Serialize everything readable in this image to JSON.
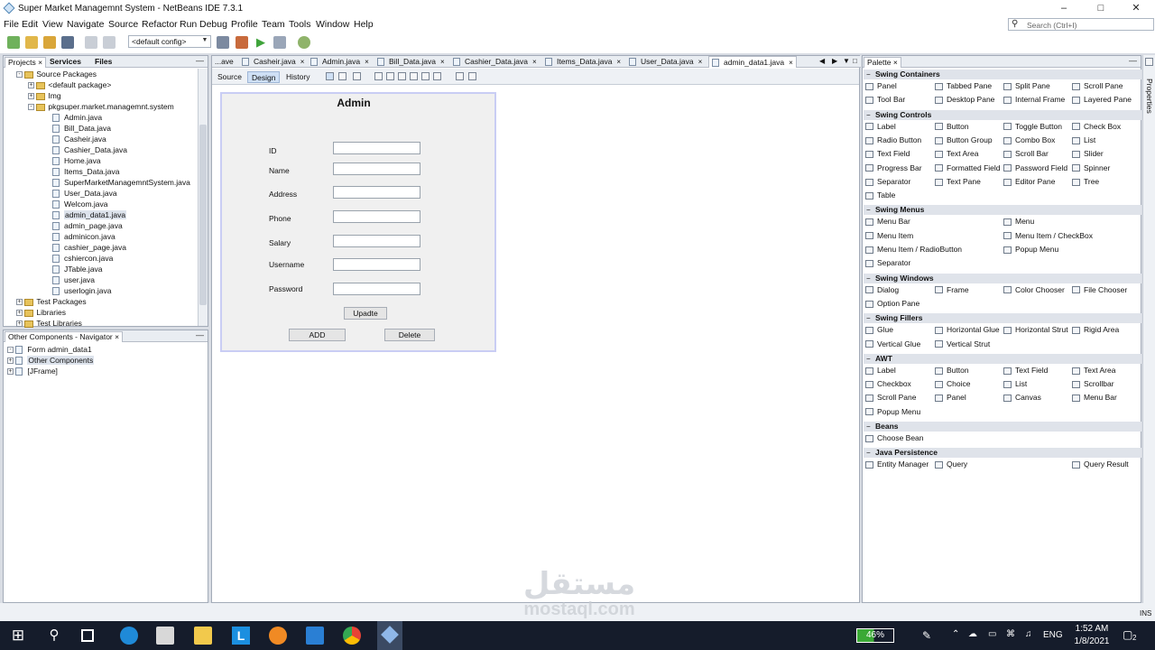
{
  "window": {
    "title": "Super Market Managemnt System - NetBeans IDE 7.3.1",
    "minimize": "–",
    "maximize": "□",
    "close": "✕"
  },
  "menu": [
    "File",
    "Edit",
    "View",
    "Navigate",
    "Source",
    "Refactor",
    "Run",
    "Debug",
    "Profile",
    "Team",
    "Tools",
    "Window",
    "Help"
  ],
  "search": {
    "placeholder": "Search (Ctrl+I)",
    "icon": "search-icon"
  },
  "toolbar": {
    "config": "<default config>"
  },
  "projects": {
    "tabs": [
      "Projects",
      "Services",
      "Files"
    ],
    "minimize": "—",
    "root": "Source Packages",
    "pkgs": [
      "<default package>",
      "Img",
      "pkgsuper.market.managemnt.system"
    ],
    "files": [
      "Admin.java",
      "Bill_Data.java",
      "Casheir.java",
      "Cashier_Data.java",
      "Home.java",
      "Items_Data.java",
      "SuperMarketManagemntSystem.java",
      "User_Data.java",
      "Welcom.java",
      "admin_data1.java",
      "admin_page.java",
      "adminicon.java",
      "cashier_page.java",
      "cshiercon.java",
      "JTable.java",
      "user.java",
      "userlogin.java"
    ],
    "selected_file": "admin_data1.java",
    "others": [
      "Test Packages",
      "Libraries",
      "Test Libraries"
    ]
  },
  "navigator": {
    "title": "Other Components - Navigator",
    "close": "×",
    "minimize": "—",
    "items": [
      "Form admin_data1",
      "Other Components",
      "[JFrame]"
    ]
  },
  "editor": {
    "tabs": [
      "...ave",
      "Casheir.java",
      "Admin.java",
      "Bill_Data.java",
      "Cashier_Data.java",
      "Items_Data.java",
      "User_Data.java",
      "admin_data1.java"
    ],
    "active_tab": "admin_data1.java",
    "modes": [
      "Source",
      "Design",
      "History"
    ],
    "active_mode": "Design"
  },
  "form": {
    "title": "Admin",
    "labels": [
      "ID",
      "Name",
      "Address",
      "Phone",
      "Salary",
      "Username",
      "Password"
    ],
    "buttons": {
      "update": "Upadte",
      "add": "ADD",
      "delete": "Delete"
    }
  },
  "palette": {
    "title": "Palette",
    "sections": [
      {
        "name": "Swing Containers",
        "items": [
          "Panel",
          "Tabbed Pane",
          "Split Pane",
          "Scroll Pane",
          "Tool Bar",
          "Desktop Pane",
          "Internal Frame",
          "Layered Pane"
        ]
      },
      {
        "name": "Swing Controls",
        "items": [
          "Label",
          "Button",
          "Toggle Button",
          "Check Box",
          "Radio Button",
          "Button Group",
          "Combo Box",
          "List",
          "Text Field",
          "Text Area",
          "Scroll Bar",
          "Slider",
          "Progress Bar",
          "Formatted Field",
          "Password Field",
          "Spinner",
          "Separator",
          "Text Pane",
          "Editor Pane",
          "Tree",
          "Table"
        ]
      },
      {
        "name": "Swing Menus",
        "items": [
          "Menu Bar",
          "",
          "Menu",
          "",
          "Menu Item",
          "",
          "Menu Item / CheckBox",
          "",
          "Menu Item / RadioButton",
          "",
          "Popup Menu",
          "",
          "Separator"
        ]
      },
      {
        "name": "Swing Windows",
        "items": [
          "Dialog",
          "Frame",
          "Color Chooser",
          "File Chooser",
          "Option Pane"
        ]
      },
      {
        "name": "Swing Fillers",
        "items": [
          "Glue",
          "Horizontal Glue",
          "Horizontal Strut",
          "Rigid Area",
          "Vertical Glue",
          "Vertical Strut"
        ]
      },
      {
        "name": "AWT",
        "items": [
          "Label",
          "Button",
          "Text Field",
          "Text Area",
          "Checkbox",
          "Choice",
          "List",
          "Scrollbar",
          "Scroll Pane",
          "Panel",
          "Canvas",
          "Menu Bar",
          "Popup Menu"
        ]
      },
      {
        "name": "Beans",
        "items": [
          "Choose Bean"
        ]
      },
      {
        "name": "Java Persistence",
        "items": [
          "Entity Manager",
          "Query",
          "",
          "Query Result"
        ]
      }
    ]
  },
  "properties_strip": "Properties",
  "status": {
    "mode": "INS"
  },
  "watermark": {
    "arabic": "مستقل",
    "latin": "mostaql.com"
  },
  "taskbar": {
    "battery": "46%",
    "lang": "ENG",
    "time": "1:52 AM",
    "date": "1/8/2021",
    "notif": "2"
  }
}
